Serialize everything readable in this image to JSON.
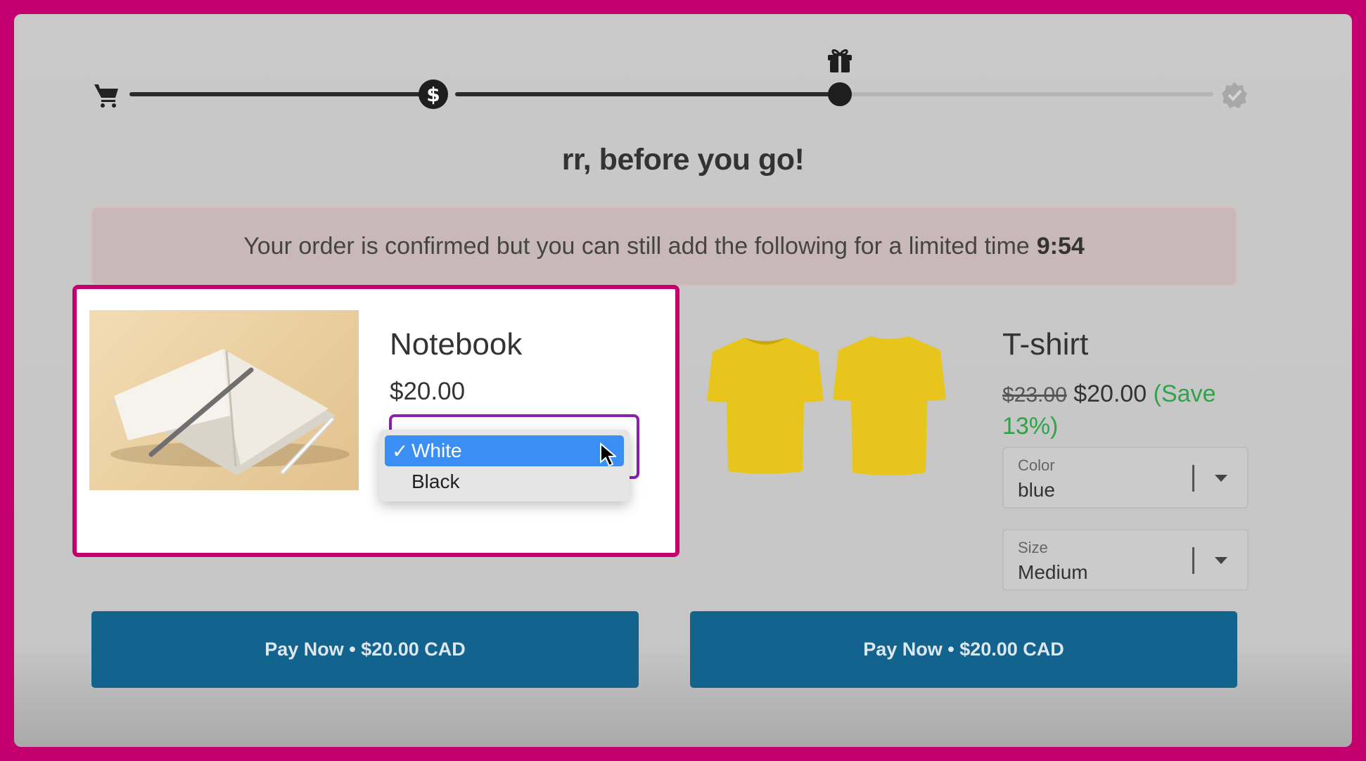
{
  "progress": {
    "steps": [
      {
        "icon": "cart-icon"
      },
      {
        "icon": "dollar-icon"
      },
      {
        "icon": "gift-icon"
      },
      {
        "icon": "verified-badge-icon"
      }
    ]
  },
  "page_title": "rr, before you go!",
  "notice": {
    "text": "Your order is confirmed but you can still add the following for a limited time",
    "timer": "9:54"
  },
  "products": [
    {
      "title": "Notebook",
      "price": "$20.00",
      "color_options": [
        "White",
        "Black"
      ],
      "selected_option": "White",
      "pay_label": "Pay Now • $20.00 CAD"
    },
    {
      "title": "T-shirt",
      "original_price": "$23.00",
      "price": "$20.00",
      "save_text": "(Save 13%)",
      "color_label": "Color",
      "color_value": "blue",
      "size_label": "Size",
      "size_value": "Medium",
      "pay_label": "Pay Now • $20.00 CAD"
    }
  ],
  "colors": {
    "accent_border": "#c4006e",
    "pay_button": "#13638f",
    "save_green": "#2fa34a",
    "dropdown_highlight": "#3b8ef3"
  }
}
